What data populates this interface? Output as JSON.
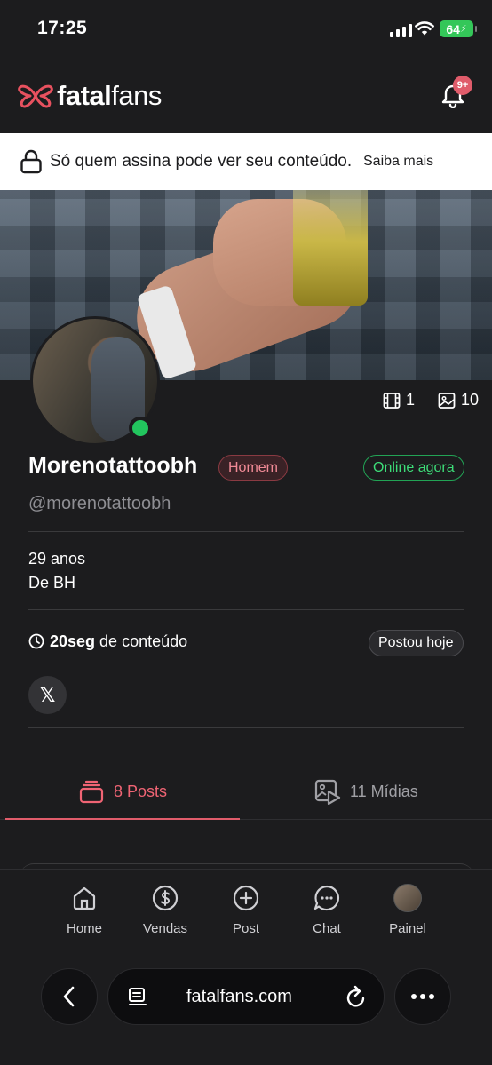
{
  "status_bar": {
    "time": "17:25",
    "battery": "64"
  },
  "header": {
    "logo_bold": "fatal",
    "logo_light": "fans",
    "notification_badge": "9+"
  },
  "notice": {
    "text": "Só quem assina pode ver seu conteúdo.",
    "link": "Saiba mais"
  },
  "profile": {
    "videos_count": "1",
    "images_count": "10",
    "name": "Morenotattoobh",
    "gender": "Homem",
    "status": "Online agora",
    "handle": "@morenotattoobh",
    "age": "29 anos",
    "location": "De BH",
    "content_duration": "20seg",
    "content_suffix": " de conteúdo",
    "posted": "Postou hoje",
    "social_x": "𝕏"
  },
  "tabs": [
    {
      "label": "8 Posts",
      "active": true
    },
    {
      "label": "11 Mídias",
      "active": false
    }
  ],
  "bottom_nav": [
    {
      "label": "Home",
      "icon": "home-icon"
    },
    {
      "label": "Vendas",
      "icon": "dollar-icon"
    },
    {
      "label": "Post",
      "icon": "plus-circle-icon"
    },
    {
      "label": "Chat",
      "icon": "chat-icon"
    },
    {
      "label": "Painel",
      "icon": "avatar"
    }
  ],
  "browser": {
    "url": "fatalfans.com"
  },
  "colors": {
    "accent": "#e05c6b",
    "online": "#22c55e",
    "background": "#1c1c1e"
  }
}
